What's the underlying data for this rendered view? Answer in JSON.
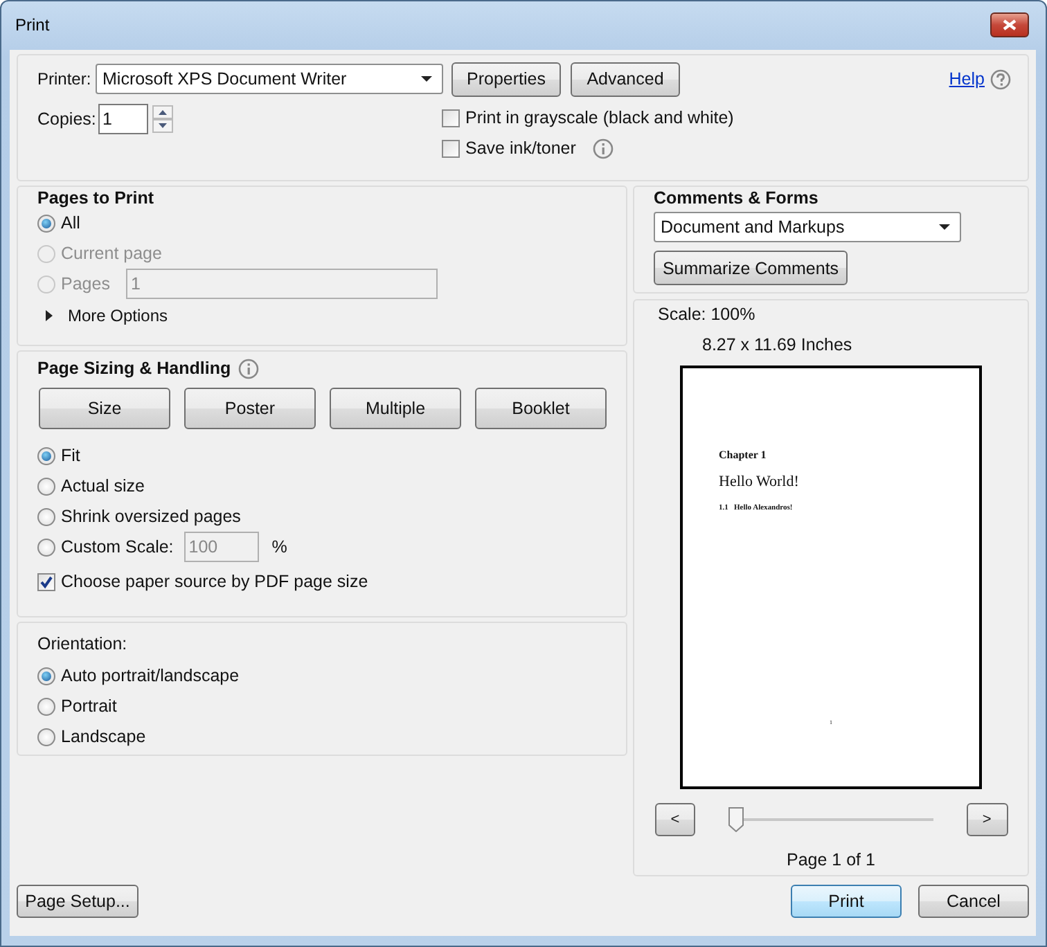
{
  "window": {
    "title": "Print"
  },
  "printer": {
    "label": "Printer:",
    "value": "Microsoft XPS Document Writer",
    "buttons": [
      "Properties",
      "Advanced"
    ],
    "help": "Help"
  },
  "copies": {
    "label": "Copies:",
    "value": "1"
  },
  "print_options": [
    {
      "label": "Print in grayscale (black and white)",
      "checked": false,
      "info": false
    },
    {
      "label": "Save ink/toner",
      "checked": false,
      "info": true
    }
  ],
  "pages_to_print": {
    "title": "Pages to Print",
    "options": [
      {
        "label": "All",
        "selected": true,
        "disabled": false
      },
      {
        "label": "Current page",
        "selected": false,
        "disabled": true
      },
      {
        "label": "Pages",
        "selected": false,
        "disabled": true,
        "field": {
          "value": "1"
        }
      }
    ],
    "more_options": {
      "label": "More Options",
      "expanded": false
    }
  },
  "page_sizing": {
    "title": "Page Sizing & Handling",
    "tabs": [
      "Size",
      "Poster",
      "Multiple",
      "Booklet"
    ],
    "options": [
      {
        "label": "Fit",
        "selected": true
      },
      {
        "label": "Actual size",
        "selected": false
      },
      {
        "label": "Shrink oversized pages",
        "selected": false
      },
      {
        "label": "Custom Scale:",
        "selected": false,
        "field": {
          "value": "100",
          "disabled": true
        },
        "unit": "%"
      }
    ],
    "paper_source": {
      "label": "Choose paper source by PDF page size",
      "checked": true
    }
  },
  "orientation": {
    "title": "Orientation:",
    "options": [
      {
        "label": "Auto portrait/landscape",
        "selected": true
      },
      {
        "label": "Portrait",
        "selected": false
      },
      {
        "label": "Landscape",
        "selected": false
      }
    ]
  },
  "comments_forms": {
    "title": "Comments & Forms",
    "value": "Document and Markups",
    "button": "Summarize Comments"
  },
  "preview": {
    "scale": "Scale: 100%",
    "size": "8.27 x 11.69 Inches",
    "page": {
      "chapter": "Chapter 1",
      "heading": "Hello World!",
      "section": "1.1   Hello Alexandros!",
      "page_number": "1"
    },
    "prev": "<",
    "next": ">",
    "slider": {
      "level": 0
    },
    "page_label": "Page 1 of 1"
  },
  "footer": {
    "page_setup": "Page Setup...",
    "print": "Print",
    "cancel": "Cancel"
  }
}
